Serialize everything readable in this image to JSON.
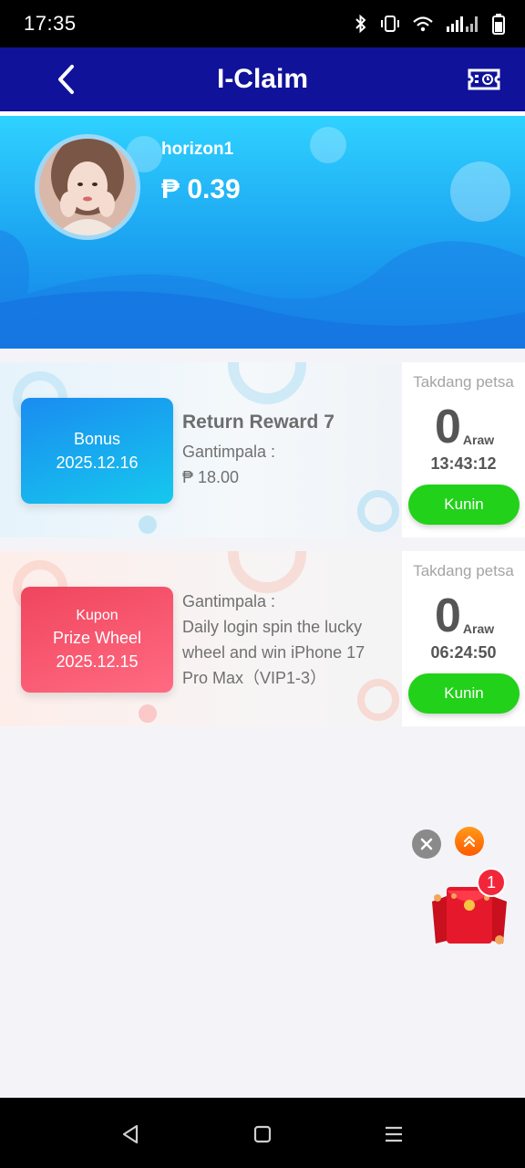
{
  "status_bar": {
    "time": "17:35"
  },
  "header": {
    "title": "I-Claim"
  },
  "profile": {
    "username": "horizon1",
    "balance": "₱ 0.39"
  },
  "cards": [
    {
      "badge_type": "Bonus",
      "badge_date": "2025.12.16",
      "name": "Return Reward 7",
      "reward_label": "Gantimpala :",
      "reward_value": "₱ 18.00",
      "limit_label": "Takdang petsa",
      "days": "0",
      "days_unit": "Araw",
      "countdown": "13:43:12",
      "claim_label": "Kunin"
    },
    {
      "badge_type": "Kupon",
      "badge_name": "Prize Wheel",
      "badge_date": "2025.12.15",
      "reward_label": "Gantimpala :",
      "description_lines": [
        "Daily login spin the lucky",
        "wheel and win iPhone 17",
        "Pro Max（VIP1-3）"
      ],
      "limit_label": "Takdang petsa",
      "days": "0",
      "days_unit": "Araw",
      "countdown": "06:24:50",
      "claim_label": "Kunin"
    }
  ],
  "floating": {
    "notification_count": "1"
  },
  "colors": {
    "header": "#10129a",
    "claim_button": "#22d11a",
    "bonus_badge": "#1a8cf0",
    "coupon_badge": "#f0455e"
  }
}
